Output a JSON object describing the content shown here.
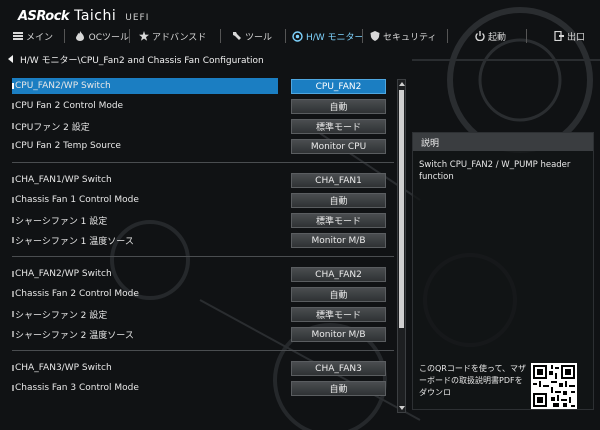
{
  "brand": {
    "name": "ASRock",
    "model": "Taichi",
    "firmware": "UEFI"
  },
  "tabs": [
    {
      "label": "メイン",
      "icon": "list-icon",
      "active": false
    },
    {
      "label": "OCツール",
      "icon": "flame-icon",
      "active": false
    },
    {
      "label": "アドバンスド",
      "icon": "star-icon",
      "active": false
    },
    {
      "label": "ツール",
      "icon": "wrench-icon",
      "active": false
    },
    {
      "label": "H/W モニター",
      "icon": "monitor-dial-icon",
      "active": true
    },
    {
      "label": "セキュリティ",
      "icon": "shield-icon",
      "active": false
    },
    {
      "label": "起動",
      "icon": "power-icon",
      "active": false
    },
    {
      "label": "出口",
      "icon": "exit-icon",
      "active": false
    }
  ],
  "breadcrumb": "H/W モニター\\CPU_Fan2 and Chassis Fan Configuration",
  "settings": [
    {
      "label": "CPU_FAN2/WP Switch",
      "value": "CPU_FAN2",
      "selected": true
    },
    {
      "label": "CPU Fan 2 Control Mode",
      "value": "自動"
    },
    {
      "label": "CPUファン 2 設定",
      "value": "標準モード"
    },
    {
      "label": "CPU Fan 2 Temp Source",
      "value": "Monitor CPU"
    },
    {
      "label": "CHA_FAN1/WP Switch",
      "value": "CHA_FAN1"
    },
    {
      "label": "Chassis Fan 1 Control Mode",
      "value": "自動"
    },
    {
      "label": "シャーシファン 1 設定",
      "value": "標準モード"
    },
    {
      "label": "シャーシファン 1 温度ソース",
      "value": "Monitor M/B"
    },
    {
      "label": "CHA_FAN2/WP Switch",
      "value": "CHA_FAN2"
    },
    {
      "label": "Chassis Fan 2 Control Mode",
      "value": "自動"
    },
    {
      "label": "シャーシファン 2 設定",
      "value": "標準モード"
    },
    {
      "label": "シャーシファン 2 温度ソース",
      "value": "Monitor M/B"
    },
    {
      "label": "CHA_FAN3/WP Switch",
      "value": "CHA_FAN3"
    },
    {
      "label": "Chassis Fan 3 Control Mode",
      "value": "自動"
    }
  ],
  "description": {
    "title": "説明",
    "text": "Switch CPU_FAN2 / W_PUMP header function",
    "qr_text": "このQRコードを使って、マザーボードの取扱説明書PDFをダウンロ"
  },
  "colors": {
    "accent": "#1b7ec2",
    "active_tab": "#7fd4ff",
    "background": "#101214"
  }
}
